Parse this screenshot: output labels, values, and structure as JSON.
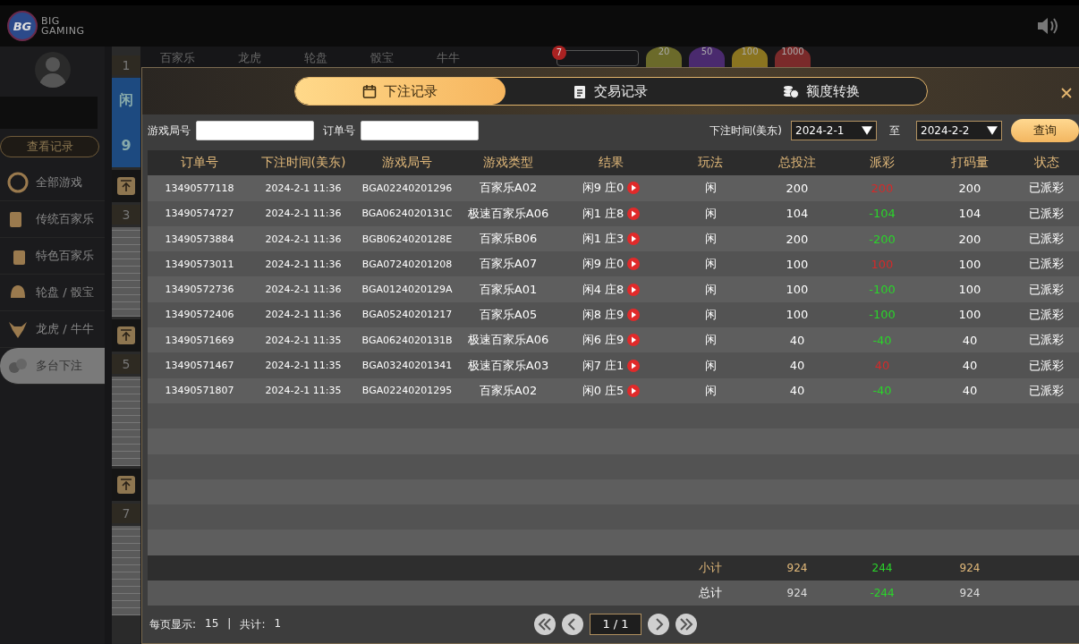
{
  "header": {
    "logo_mark": "BG",
    "logo_line1": "BIG",
    "logo_line2": "GAMING"
  },
  "categories": [
    {
      "label": "百家乐"
    },
    {
      "label": "龙虎"
    },
    {
      "label": "轮盘"
    },
    {
      "label": "骰宝"
    },
    {
      "label": "牛牛"
    }
  ],
  "limit_badge": "7",
  "chips": [
    {
      "value": "20",
      "color": "#6b6a2a"
    },
    {
      "value": "50",
      "color": "#4a2a6e"
    },
    {
      "value": "100",
      "color": "#8a7420"
    },
    {
      "value": "1000",
      "color": "#7a2a2a"
    }
  ],
  "sidebar": {
    "history_button": "查看记录",
    "items": [
      {
        "label": "全部游戏",
        "selected": false
      },
      {
        "label": "传统百家乐",
        "selected": false
      },
      {
        "label": "特色百家乐",
        "selected": false
      },
      {
        "label": "轮盘 / 骰宝",
        "selected": false
      },
      {
        "label": "龙虎 / 牛牛",
        "selected": false
      },
      {
        "label": "多台下注",
        "selected": true
      }
    ]
  },
  "strip": [
    {
      "kind": "number",
      "text": "1"
    },
    {
      "kind": "result",
      "text": "闲",
      "score": "9"
    },
    {
      "kind": "pin"
    },
    {
      "kind": "number",
      "text": "3"
    },
    {
      "kind": "road"
    },
    {
      "kind": "pin"
    },
    {
      "kind": "number",
      "text": "5"
    },
    {
      "kind": "road"
    },
    {
      "kind": "pin"
    },
    {
      "kind": "number",
      "text": "7"
    },
    {
      "kind": "road"
    }
  ],
  "modal": {
    "tabs": [
      {
        "label": "下注记录",
        "selected": true
      },
      {
        "label": "交易记录",
        "selected": false
      },
      {
        "label": "额度转换",
        "selected": false
      }
    ],
    "filters": {
      "round_label": "游戏局号",
      "order_label": "订单号",
      "time_label": "下注时间(美东)",
      "date_from": "2024-2-1",
      "to_label": "至",
      "date_to": "2024-2-2",
      "search_button": "查询"
    },
    "columns": [
      "订单号",
      "下注时间(美东)",
      "游戏局号",
      "游戏类型",
      "结果",
      "玩法",
      "总投注",
      "派彩",
      "打码量",
      "状态"
    ],
    "rows": [
      {
        "order": "13490577118",
        "time": "2024-2-1 11:36",
        "round": "BGA02240201296",
        "game": "百家乐A02",
        "result": "闲9 庄0",
        "bet_type": "闲",
        "total_bet": "200",
        "payout": "200",
        "color": "#d42a2a",
        "turnover": "200",
        "status": "已派彩"
      },
      {
        "order": "13490574727",
        "time": "2024-2-1 11:36",
        "round": "BGA0624020131C",
        "game": "极速百家乐A06",
        "result": "闲1 庄8",
        "bet_type": "闲",
        "total_bet": "104",
        "payout": "-104",
        "color": "#2ad42a",
        "turnover": "104",
        "status": "已派彩"
      },
      {
        "order": "13490573884",
        "time": "2024-2-1 11:36",
        "round": "BGB0624020128E",
        "game": "百家乐B06",
        "result": "闲1 庄3",
        "bet_type": "闲",
        "total_bet": "200",
        "payout": "-200",
        "color": "#2ad42a",
        "turnover": "200",
        "status": "已派彩"
      },
      {
        "order": "13490573011",
        "time": "2024-2-1 11:36",
        "round": "BGA07240201208",
        "game": "百家乐A07",
        "result": "闲9 庄0",
        "bet_type": "闲",
        "total_bet": "100",
        "payout": "100",
        "color": "#d42a2a",
        "turnover": "100",
        "status": "已派彩"
      },
      {
        "order": "13490572736",
        "time": "2024-2-1 11:36",
        "round": "BGA0124020129A",
        "game": "百家乐A01",
        "result": "闲4 庄8",
        "bet_type": "闲",
        "total_bet": "100",
        "payout": "-100",
        "color": "#2ad42a",
        "turnover": "100",
        "status": "已派彩"
      },
      {
        "order": "13490572406",
        "time": "2024-2-1 11:36",
        "round": "BGA05240201217",
        "game": "百家乐A05",
        "result": "闲8 庄9",
        "bet_type": "闲",
        "total_bet": "100",
        "payout": "-100",
        "color": "#2ad42a",
        "turnover": "100",
        "status": "已派彩"
      },
      {
        "order": "13490571669",
        "time": "2024-2-1 11:35",
        "round": "BGA0624020131B",
        "game": "极速百家乐A06",
        "result": "闲6 庄9",
        "bet_type": "闲",
        "total_bet": "40",
        "payout": "-40",
        "color": "#2ad42a",
        "turnover": "40",
        "status": "已派彩"
      },
      {
        "order": "13490571467",
        "time": "2024-2-1 11:35",
        "round": "BGA03240201341",
        "game": "极速百家乐A03",
        "result": "闲7 庄1",
        "bet_type": "闲",
        "total_bet": "40",
        "payout": "40",
        "color": "#d42a2a",
        "turnover": "40",
        "status": "已派彩"
      },
      {
        "order": "13490571807",
        "time": "2024-2-1 11:35",
        "round": "BGA02240201295",
        "game": "百家乐A02",
        "result": "闲0 庄5",
        "bet_type": "闲",
        "total_bet": "40",
        "payout": "-40",
        "color": "#2ad42a",
        "turnover": "40",
        "status": "已派彩"
      }
    ],
    "summary": [
      {
        "label": "小计",
        "total_bet": "924",
        "payout": "244",
        "turnover": "924"
      },
      {
        "label": "总计",
        "total_bet": "924",
        "payout": "-244",
        "turnover": "924"
      }
    ],
    "footer": {
      "per_page_label": "每页显示:",
      "per_page": "15",
      "separator": "|",
      "total_label": "共计:",
      "total": "1",
      "page": "1 / 1"
    }
  }
}
